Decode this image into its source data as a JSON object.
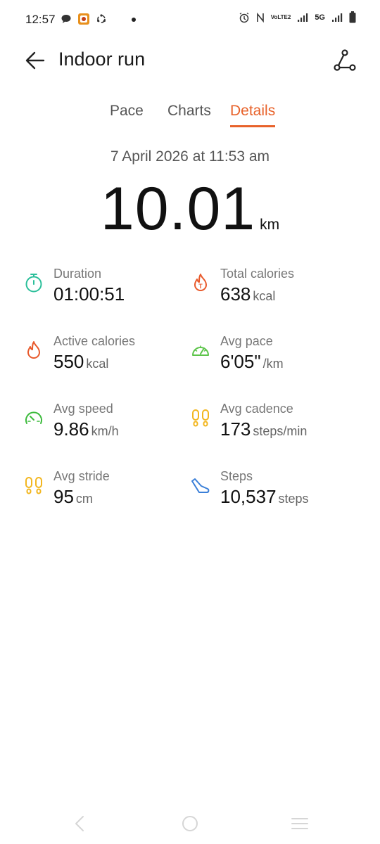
{
  "status_bar": {
    "time": "12:57",
    "network_volte": "VoLTE2",
    "network_5g": "5G",
    "icons": [
      "chat-bubble-icon",
      "app-notification-icon",
      "sync-icon",
      "alarm-icon",
      "nfc-icon",
      "signal-icon",
      "battery-icon"
    ]
  },
  "header": {
    "title": "Indoor run",
    "back_icon": "arrow-left-icon",
    "route_icon": "route-icon"
  },
  "tabs": [
    {
      "label": "Pace",
      "active": false
    },
    {
      "label": "Charts",
      "active": false
    },
    {
      "label": "Details",
      "active": true
    }
  ],
  "summary": {
    "date": "7 April 2026 at 11:53 am",
    "distance": "10.01",
    "distance_unit": "km"
  },
  "metrics": [
    {
      "label": "Duration",
      "value": "01:00:51",
      "unit": "",
      "icon": "stopwatch-icon",
      "color": "#2bbf9a"
    },
    {
      "label": "Total calories",
      "value": "638",
      "unit": "kcal",
      "icon": "flame-t-icon",
      "color": "#e85a2c"
    },
    {
      "label": "Active calories",
      "value": "550",
      "unit": "kcal",
      "icon": "flame-icon",
      "color": "#e85a2c"
    },
    {
      "label": "Avg pace",
      "value": "6'05\"",
      "unit": "/km",
      "icon": "gauge-icon",
      "color": "#5cc44a"
    },
    {
      "label": "Avg speed",
      "value": "9.86",
      "unit": "km/h",
      "icon": "speedometer-icon",
      "color": "#3dbb3d"
    },
    {
      "label": "Avg cadence",
      "value": "173",
      "unit": "steps/min",
      "icon": "footprints-icon",
      "color": "#f2b61f"
    },
    {
      "label": "Avg stride",
      "value": "95",
      "unit": "cm",
      "icon": "footprints-icon",
      "color": "#f2b61f"
    },
    {
      "label": "Steps",
      "value": "10,537",
      "unit": "steps",
      "icon": "shoe-icon",
      "color": "#3a7fd8"
    }
  ],
  "accent_color": "#e8622a"
}
